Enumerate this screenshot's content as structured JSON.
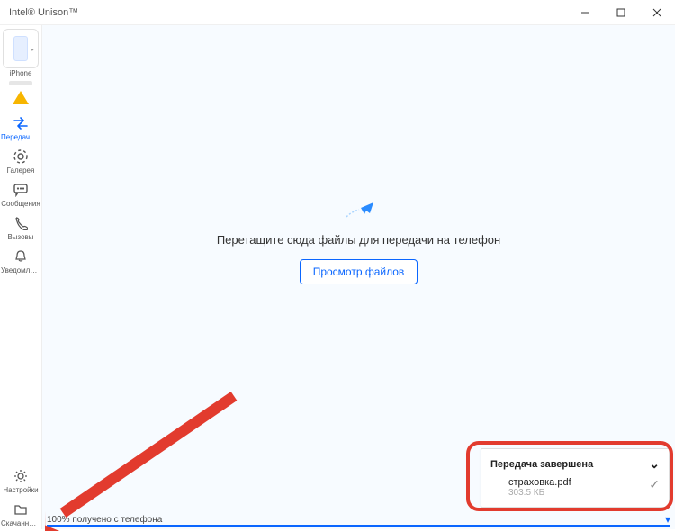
{
  "window": {
    "title": "Intel® Unison™"
  },
  "device": {
    "name": "iPhone"
  },
  "sidebar": {
    "items": [
      {
        "key": "transfer",
        "label": "Передача ...",
        "active": true
      },
      {
        "key": "gallery",
        "label": "Галерея",
        "active": false
      },
      {
        "key": "messages",
        "label": "Сообщения",
        "active": false
      },
      {
        "key": "calls",
        "label": "Вызовы",
        "active": false
      },
      {
        "key": "notifs",
        "label": "Уведомлен...",
        "active": false
      }
    ],
    "footer": [
      {
        "key": "settings",
        "label": "Настройки"
      },
      {
        "key": "downloads",
        "label": "Скачанные..."
      }
    ]
  },
  "main": {
    "dropzone_text": "Перетащите сюда файлы для передачи на телефон",
    "browse_label": "Просмотр файлов"
  },
  "transfer": {
    "title": "Передача завершена",
    "file": {
      "name": "страховка.pdf",
      "size": "303.5 КБ"
    }
  },
  "status": {
    "text": "100% получено с телефона",
    "percent": 100
  },
  "annotation": {
    "present": true
  }
}
